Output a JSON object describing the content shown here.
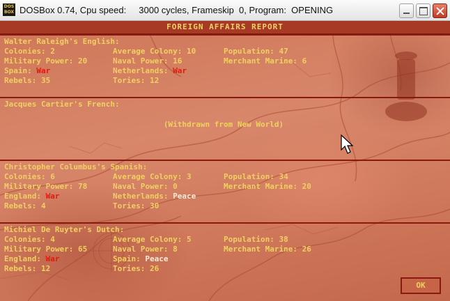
{
  "window": {
    "title": "DOSBox 0.74, Cpu speed:     3000 cycles, Frameskip  0, Program:  OPENING",
    "icon_text_top": "DOS",
    "icon_text_bottom": "BOX"
  },
  "report": {
    "header": "FOREIGN AFFAIRS REPORT",
    "ok_label": "OK",
    "nations": [
      {
        "title": "Walter Raleigh's English:",
        "stats": [
          {
            "label": "Colonies:",
            "value": "2"
          },
          {
            "label": "Average Colony:",
            "value": "10"
          },
          {
            "label": "Population:",
            "value": "47"
          },
          {
            "label": "Military Power:",
            "value": "20"
          },
          {
            "label": "Naval Power:",
            "value": "16"
          },
          {
            "label": "Merchant Marine:",
            "value": "6"
          },
          {
            "label": "Spain:",
            "value": "War"
          },
          {
            "label": "Netherlands:",
            "value": "War"
          },
          {
            "label": "Rebels:",
            "value": "35"
          },
          {
            "label": "Tories:",
            "value": "12"
          }
        ]
      },
      {
        "title": "Jacques Cartier's French:",
        "status": "(Withdrawn from New World)"
      },
      {
        "title": "Christopher Columbus's Spanish:",
        "stats": [
          {
            "label": "Colonies:",
            "value": "6"
          },
          {
            "label": "Average Colony:",
            "value": "3"
          },
          {
            "label": "Population:",
            "value": "34"
          },
          {
            "label": "Military Power:",
            "value": "78"
          },
          {
            "label": "Naval Power:",
            "value": "0"
          },
          {
            "label": "Merchant Marine:",
            "value": "20"
          },
          {
            "label": "England:",
            "value": "War"
          },
          {
            "label": "Netherlands:",
            "value": "Peace"
          },
          {
            "label": "Rebels:",
            "value": "4"
          },
          {
            "label": "Tories:",
            "value": "30"
          }
        ]
      },
      {
        "title": "Michiel De Ruyter's Dutch:",
        "stats": [
          {
            "label": "Colonies:",
            "value": "4"
          },
          {
            "label": "Average Colony:",
            "value": "5"
          },
          {
            "label": "Population:",
            "value": "38"
          },
          {
            "label": "Military Power:",
            "value": "65"
          },
          {
            "label": "Naval Power:",
            "value": "8"
          },
          {
            "label": "Merchant Marine:",
            "value": "26"
          },
          {
            "label": "England:",
            "value": "War"
          },
          {
            "label": "Spain:",
            "value": "Peace"
          },
          {
            "label": "Rebels:",
            "value": "12"
          },
          {
            "label": "Tories:",
            "value": "26"
          }
        ]
      }
    ]
  },
  "colors": {
    "war": "#e8170b",
    "peace": "#f4ecd8",
    "text": "#f0d060",
    "separator": "#8a1a10"
  },
  "icons": [
    "dosbox-icon",
    "minimize-icon",
    "maximize-icon",
    "close-icon",
    "mouse-cursor-icon"
  ]
}
